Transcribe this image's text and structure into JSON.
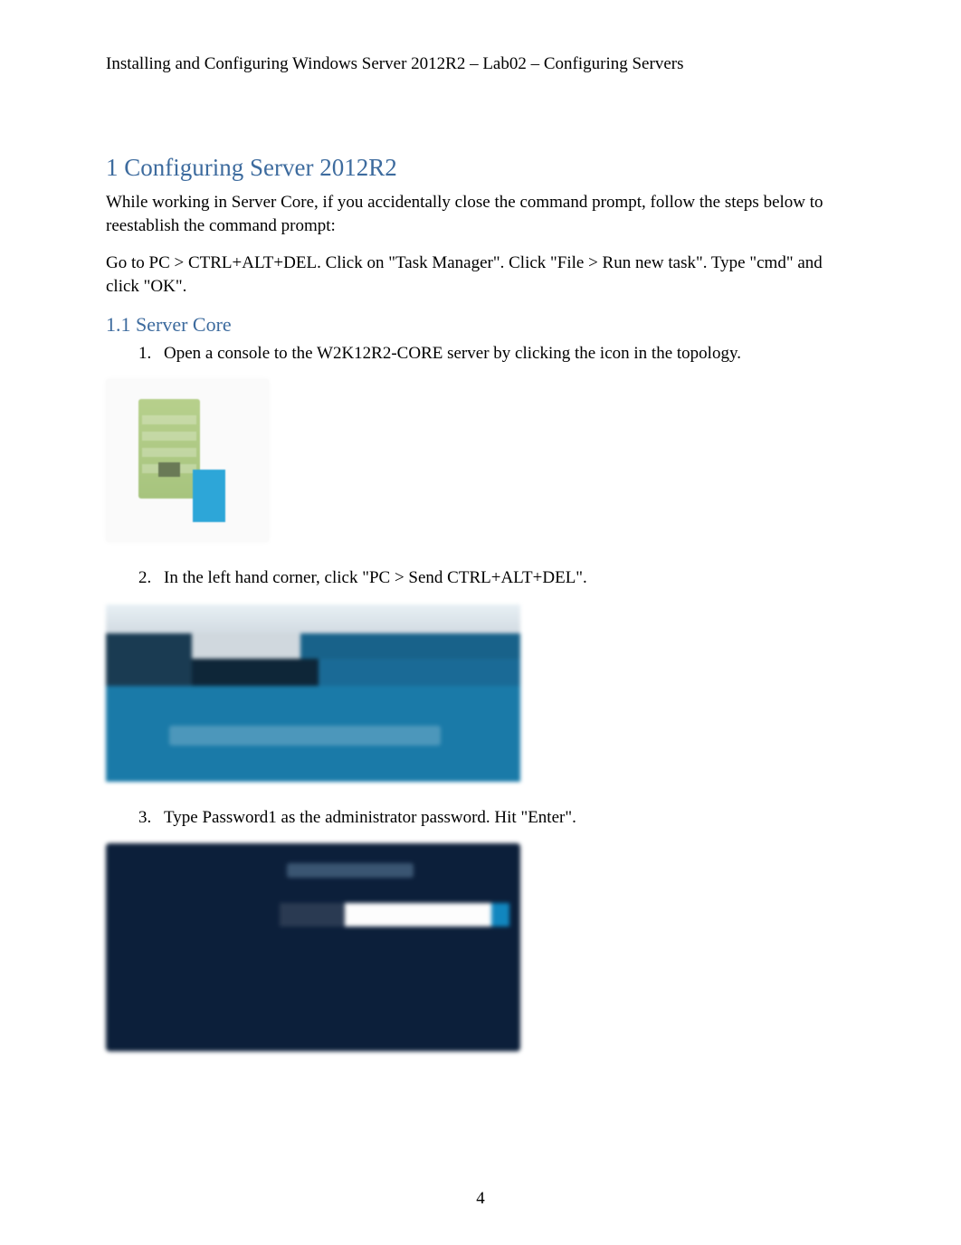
{
  "header": "Installing and Configuring Windows Server 2012R2 – Lab02 – Configuring Servers",
  "section1": {
    "number": "1",
    "title": "Configuring Server 2012R2",
    "intro1": "While working in Server Core, if you accidentally close the command prompt, follow the steps below to reestablish the command prompt:",
    "intro2": "Go to PC > CTRL+ALT+DEL. Click on \"Task Manager\". Click \"File > Run new task\". Type \"cmd\" and click \"OK\"."
  },
  "section1_1": {
    "number": "1.1",
    "title": "Server Core",
    "steps": [
      {
        "num": "1.",
        "text": "Open a console to the W2K12R2-CORE server by clicking the icon in the topology."
      },
      {
        "num": "2.",
        "text": "In the left hand corner, click \"PC > Send CTRL+ALT+DEL\"."
      },
      {
        "num": "3.",
        "text": "Type Password1  as the administrator password. Hit \"Enter\"."
      }
    ]
  },
  "images": {
    "img1_alt": "topology-console-icon",
    "img2_alt": "send-ctrl-alt-del-screen",
    "img3_alt": "administrator-password-login-screen"
  },
  "page_number": "4"
}
